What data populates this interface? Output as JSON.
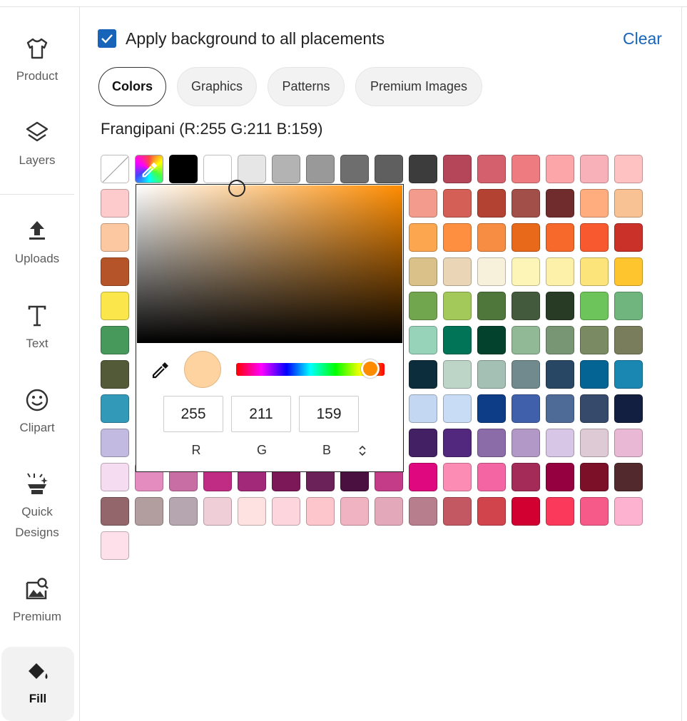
{
  "sidebar": {
    "items": [
      {
        "label": "Product",
        "icon": "tshirt-icon"
      },
      {
        "label": "Layers",
        "icon": "layers-icon"
      },
      {
        "label": "Uploads",
        "icon": "upload-icon"
      },
      {
        "label": "Text",
        "icon": "text-icon"
      },
      {
        "label": "Clipart",
        "icon": "smiley-icon"
      },
      {
        "label": "Quick",
        "label2": "Designs",
        "icon": "sparkle-icon"
      },
      {
        "label": "Premium",
        "icon": "image-search-icon"
      },
      {
        "label": "Fill",
        "icon": "paint-bucket-icon",
        "active": true
      }
    ]
  },
  "header": {
    "apply_label": "Apply background to all placements",
    "apply_checked": true,
    "clear_label": "Clear"
  },
  "tabs": [
    {
      "label": "Colors",
      "active": true
    },
    {
      "label": "Graphics"
    },
    {
      "label": "Patterns"
    },
    {
      "label": "Premium Images"
    }
  ],
  "selected_color": {
    "name": "Frangipani (R:255 G:211 B:159)",
    "hex": "#ffd39f"
  },
  "picker": {
    "r": "255",
    "g": "211",
    "b": "159",
    "r_label": "R",
    "g_label": "G",
    "b_label": "B",
    "hue_color": "#ff8c00"
  },
  "swatches": [
    [
      "none",
      "picker",
      "#000000",
      "#ffffff",
      "#e6e6e6",
      "#b3b3b3",
      "#999999",
      "#6e6e6e",
      "#5f5f5f",
      "#3c3c3c",
      "#b5465a",
      "#d4606e",
      "#ee7b7f",
      "#fca6aa",
      "#f8b1b8",
      "#ffc2c2"
    ],
    [
      "#fdcbcb",
      "",
      "",
      "",
      "",
      "",
      "",
      "",
      "",
      "#f39c8e",
      "#d35f56",
      "#b44233",
      "#a14f48",
      "#702c2d",
      "#ffad7f",
      "#f9c294"
    ],
    [
      "#fbc8a2",
      "",
      "",
      "",
      "",
      "",
      "",
      "",
      "",
      "#fca64f",
      "#fe8f40",
      "#f78d42",
      "#e8691a",
      "#f6692a",
      "#f9592f",
      "#ca3129"
    ],
    [
      "#b45428",
      "",
      "",
      "",
      "",
      "",
      "",
      "",
      "",
      "#dac089",
      "#ead6b6",
      "#f7f0da",
      "#fdf5b8",
      "#fdf1aa",
      "#fde47a",
      "#fec52e"
    ],
    [
      "#fbe64c",
      "",
      "",
      "",
      "",
      "",
      "",
      "",
      "",
      "#72a64e",
      "#a3c95a",
      "#4f763b",
      "#435a3c",
      "#283b24",
      "#6dc45a",
      "#6fb57d"
    ],
    [
      "#46985b",
      "",
      "",
      "",
      "",
      "",
      "",
      "",
      "",
      "#97d3b9",
      "#017357",
      "#03432e",
      "#91b996",
      "#789674",
      "#7a8a62",
      "#7a7d5b"
    ],
    [
      "#535a38",
      "",
      "",
      "",
      "",
      "",
      "",
      "",
      "",
      "#0c2e3c",
      "#bcd5c6",
      "#a4c0b5",
      "#708a8e",
      "#274764",
      "#046594",
      "#1987b2"
    ],
    [
      "#3399b9",
      "",
      "",
      "",
      "",
      "",
      "",
      "",
      "",
      "#c3d7f3",
      "#c8dcf5",
      "#0e3d87",
      "#4160ab",
      "#4e6b97",
      "#364a6b",
      "#121f40"
    ],
    [
      "#c2bae0",
      "",
      "",
      "",
      "",
      "",
      "",
      "",
      "",
      "#432063",
      "#51287d",
      "#8b6ba8",
      "#b298c6",
      "#d8c6e6",
      "#decad4",
      "#e8b8d4"
    ],
    [
      "#f6dcf0",
      "#e48cc0",
      "#c86ea4",
      "#c02c84",
      "#a2287a",
      "#7c1858",
      "#6a2258",
      "#4a1040",
      "#c43c88",
      "#e0087f",
      "#fd8cb5",
      "#f466a3",
      "#a42a58",
      "#950040",
      "#7c1028",
      "#522a2e"
    ],
    [
      "#92666a",
      "#b29e9e",
      "#b6a6b0",
      "#f0ced8",
      "#fee2e2",
      "#fdd5dc",
      "#fdc5cc",
      "#f0b3c1",
      "#e4a8bb",
      "#b77e8e",
      "#c35862",
      "#d1444c",
      "#d20030",
      "#fb395b",
      "#f55a88",
      "#fdb3d0"
    ],
    [
      "#fde0ea"
    ]
  ]
}
